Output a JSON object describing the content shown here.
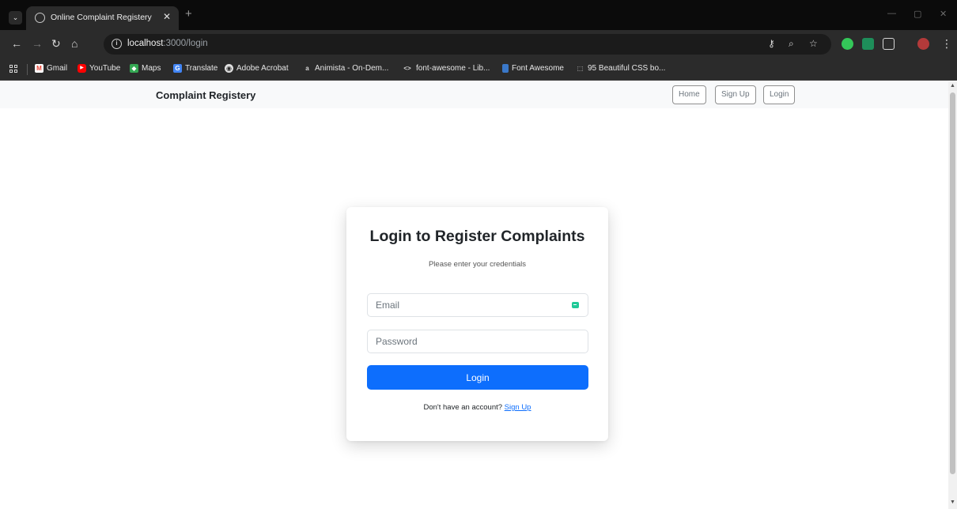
{
  "browser": {
    "tab_title": "Online Complaint Registery",
    "url_host": "localhost",
    "url_rest": ":3000/login",
    "bookmarks": [
      {
        "label": "Gmail",
        "color": "#ea4335",
        "glyph": "M"
      },
      {
        "label": "YouTube",
        "color": "#ff0000",
        "glyph": "▶"
      },
      {
        "label": "Maps",
        "color": "#34a853",
        "glyph": "◆"
      },
      {
        "label": "Translate",
        "color": "#4285f4",
        "glyph": "G"
      },
      {
        "label": "Adobe Acrobat",
        "color": "#e0e0e0",
        "glyph": "◉"
      },
      {
        "label": "Animista - On-Dem...",
        "color": "#2b2b2b",
        "glyph": "a"
      },
      {
        "label": "font-awesome - Lib...",
        "color": "#2b2b2b",
        "glyph": "<>"
      },
      {
        "label": "Font Awesome",
        "color": "#3a78c9",
        "glyph": "▮"
      },
      {
        "label": "95 Beautiful CSS bo...",
        "color": "#2b2b2b",
        "glyph": "⬚"
      }
    ]
  },
  "navbar": {
    "brand": "Complaint Registery",
    "links": [
      "Home",
      "Sign Up",
      "Login"
    ]
  },
  "login": {
    "title": "Login to Register Complaints",
    "subtitle": "Please enter your credentials",
    "email_placeholder": "Email",
    "password_placeholder": "Password",
    "button": "Login",
    "signup_prompt": "Don't have an account?",
    "signup_link": "Sign Up"
  },
  "colors": {
    "primary": "#0d6efd",
    "navbar_bg": "#f8f9fa"
  }
}
